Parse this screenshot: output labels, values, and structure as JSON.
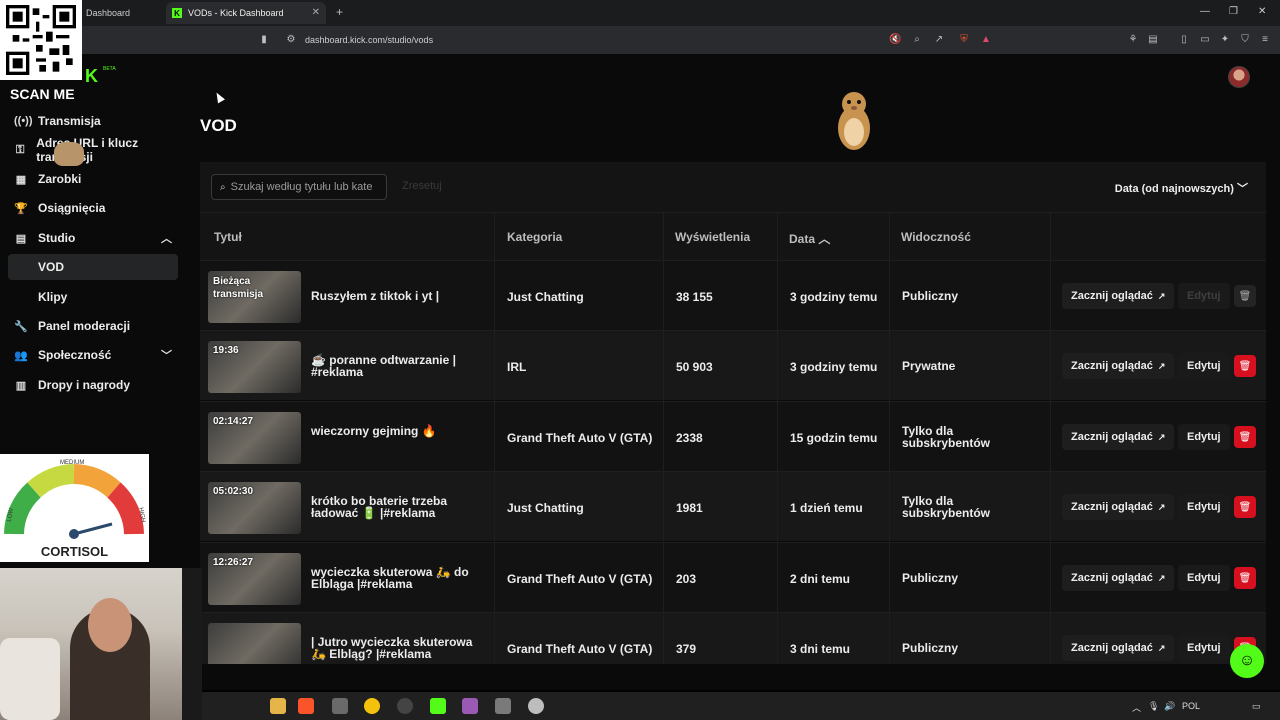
{
  "browser": {
    "tabs": [
      {
        "label": "Dashboard"
      },
      {
        "label": "VODs - Kick Dashboard",
        "favicon": "K"
      }
    ],
    "url": "dashboard.kick.com/studio/vods"
  },
  "overlay": {
    "scan_me": "SCAN ME",
    "cortisol": "CORTISOL",
    "gauge": {
      "low": "LOW",
      "medium": "MEDIUM",
      "high": "HIGH"
    }
  },
  "brand": {
    "beta": "BETA",
    "accent": "#53fc18"
  },
  "sidebar": {
    "items": [
      {
        "label": "Transmisja",
        "icon": "broadcast-icon"
      },
      {
        "label": "Adres URL i klucz transmisji",
        "icon": "key-icon"
      },
      {
        "label": "Zarobki",
        "icon": "wallet-icon"
      },
      {
        "label": "Osiągnięcia",
        "icon": "trophy-icon"
      },
      {
        "label": "Studio",
        "icon": "studio-icon"
      },
      {
        "label": "VOD"
      },
      {
        "label": "Klipy"
      },
      {
        "label": "Panel moderacji",
        "icon": "wrench-icon"
      },
      {
        "label": "Społeczność",
        "icon": "community-icon"
      },
      {
        "label": "Dropy i nagrody",
        "icon": "gift-icon"
      }
    ]
  },
  "page": {
    "title": "VOD"
  },
  "toolbar": {
    "search_placeholder": "Szukaj według tytułu lub kate",
    "reset_label": "Zresetuj",
    "sort_label": "Data (od najnowszych)"
  },
  "table": {
    "headers": {
      "title": "Tytuł",
      "category": "Kategoria",
      "views": "Wyświetlenia",
      "date": "Data",
      "visibility": "Widoczność"
    },
    "watch_label": "Zacznij oglądać",
    "edit_label": "Edytuj",
    "rows": [
      {
        "duration": "Bieżąca transmisja",
        "title": "Ruszyłem z tiktok i yt |",
        "category": "Just Chatting",
        "views": "38 155",
        "date": "3 godziny temu",
        "visibility": "Publiczny",
        "editable": false
      },
      {
        "duration": "19:36",
        "title": "☕ poranne odtwarzanie | #reklama",
        "category": "IRL",
        "views": "50 903",
        "date": "3 godziny temu",
        "visibility": "Prywatne",
        "editable": true
      },
      {
        "duration": "02:14:27",
        "title": "wieczorny gejming 🔥",
        "category": "Grand Theft Auto V (GTA)",
        "views": "2338",
        "date": "15 godzin temu",
        "visibility": "Tylko dla subskrybentów",
        "editable": true
      },
      {
        "duration": "05:02:30",
        "title": "krótko bo baterie trzeba ładować 🔋 |#reklama",
        "category": "Just Chatting",
        "views": "1981",
        "date": "1 dzień temu",
        "visibility": "Tylko dla subskrybentów",
        "editable": true
      },
      {
        "duration": "12:26:27",
        "title": "wycieczka skuterowa 🛵 do Elbląga |#reklama",
        "category": "Grand Theft Auto V (GTA)",
        "views": "203",
        "date": "2 dni temu",
        "visibility": "Publiczny",
        "editable": true
      },
      {
        "duration": "",
        "title": "| Jutro wycieczka skuterowa 🛵 Elbląg? |#reklama",
        "category": "Grand Theft Auto V (GTA)",
        "views": "379",
        "date": "3 dni temu",
        "visibility": "Publiczny",
        "editable": true
      }
    ]
  },
  "taskbar": {
    "lang": "POL"
  }
}
